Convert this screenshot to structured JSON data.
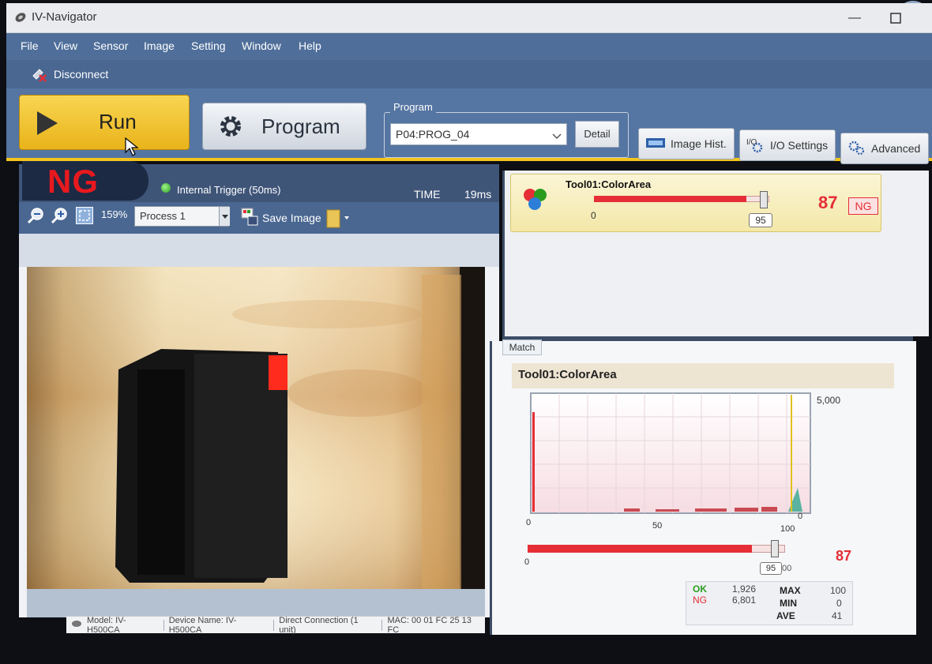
{
  "window": {
    "title": "IV-Navigator",
    "minimize": "—"
  },
  "menu": [
    "File",
    "View",
    "Sensor",
    "Image",
    "Setting",
    "Window",
    "Help"
  ],
  "toolbar": {
    "disconnect": "Disconnect"
  },
  "main_buttons": {
    "run": "Run",
    "program": "Program",
    "program_group_label": "Program",
    "program_selected": "P04:PROG_04",
    "detail": "Detail",
    "image_hist": "Image Hist.",
    "io_settings": "I/O Settings",
    "advanced": "Advanced"
  },
  "status": {
    "result": "NG",
    "trigger": "Internal Trigger (50ms)",
    "time_label": "TIME",
    "time_value": "19ms"
  },
  "image_toolbar": {
    "zoom": "159%",
    "process": "Process 1",
    "save_image": "Save Image"
  },
  "statusbar": {
    "model": "Model: IV-H500CA",
    "device": "Device Name: IV-H500CA",
    "connection": "Direct Connection (1 unit)",
    "mac": "MAC: 00 01 FC 25 13 FC"
  },
  "tool": {
    "name": "Tool01:ColorArea",
    "min_label": "0",
    "threshold": "95",
    "value": "87",
    "value_fraction": 0.87,
    "judgement": "NG"
  },
  "match": {
    "tab": "Match",
    "graph_title": "Tool01:ColorArea",
    "x_ticks": [
      "0",
      "50",
      "100"
    ],
    "y_top": "5,000",
    "y_bottom": "0",
    "bar_min": "0",
    "threshold": "95",
    "threshold_suffix": "00",
    "value": "87",
    "value_fraction": 0.87,
    "stats": {
      "ok_label": "OK",
      "ok_count": "1,926",
      "ng_label": "NG",
      "ng_count": "6,801",
      "max_label": "MAX",
      "max": "100",
      "min_label": "MIN",
      "min": "0",
      "ave_label": "AVE",
      "ave": "41"
    }
  },
  "colors": {
    "ng_red": "#e52e35",
    "accent_yellow": "#f3c51c",
    "menu_blue": "#4f6f9a",
    "ok_green": "#2a9d1f"
  }
}
